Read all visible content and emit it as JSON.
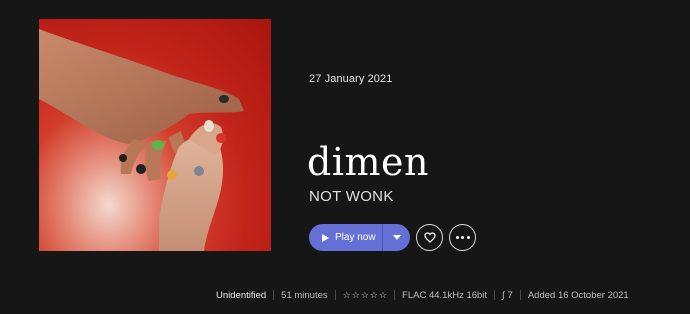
{
  "album": {
    "release_date": "27 January 2021",
    "title": "dimen",
    "artist": "NOT WONK"
  },
  "actions": {
    "play_label": "Play now",
    "play_more_icon": "chevron-down-icon",
    "favorite_icon": "heart-icon",
    "more_icon": "ellipsis-icon",
    "accent_color": "#6470d6"
  },
  "meta": {
    "genre": "Unidentified",
    "duration": "51 minutes",
    "rating_stars": 0,
    "rating_max": 5,
    "format": "FLAC 44.1kHz 16bit",
    "tracks": "7",
    "added": "Added 16 October 2021"
  }
}
